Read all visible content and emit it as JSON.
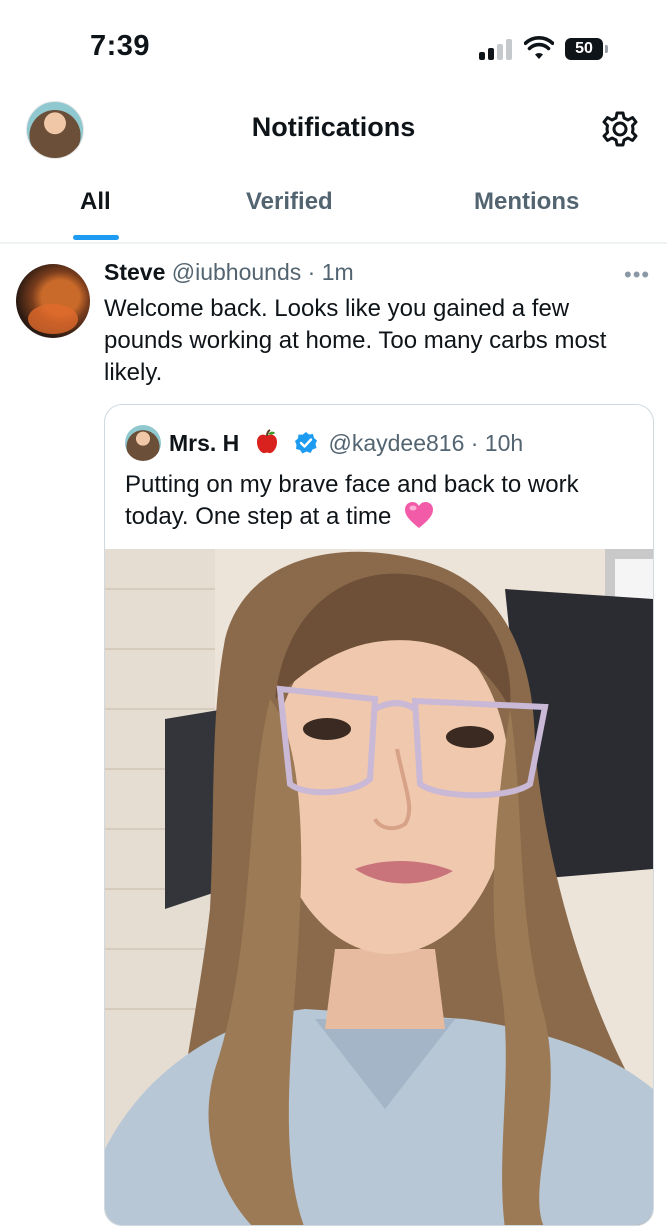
{
  "status_bar": {
    "time": "7:39",
    "battery": "50",
    "battery_level": 0.5
  },
  "header": {
    "title": "Notifications"
  },
  "tabs": [
    {
      "label": "All",
      "active": true
    },
    {
      "label": "Verified",
      "active": false
    },
    {
      "label": "Mentions",
      "active": false
    }
  ],
  "notification": {
    "name": "Steve",
    "meta": "@iubhounds · 1m",
    "text": "Welcome back. Looks like you gained a few pounds working at home. Too many carbs most likely.",
    "quoted": {
      "name": "Mrs. H",
      "meta": "@kaydee816 · 10h",
      "text": "Putting on my brave face and back to work today. One step at a time"
    }
  },
  "colors": {
    "accent": "#1d9bf0",
    "text": "#0f1419",
    "secondary": "#536471"
  },
  "icons": [
    "signal-icon",
    "wifi-icon",
    "battery-icon",
    "settings-gear-icon",
    "more-icon",
    "apple-emoji-icon",
    "verified-badge-icon",
    "pink-heart-emoji-icon"
  ]
}
